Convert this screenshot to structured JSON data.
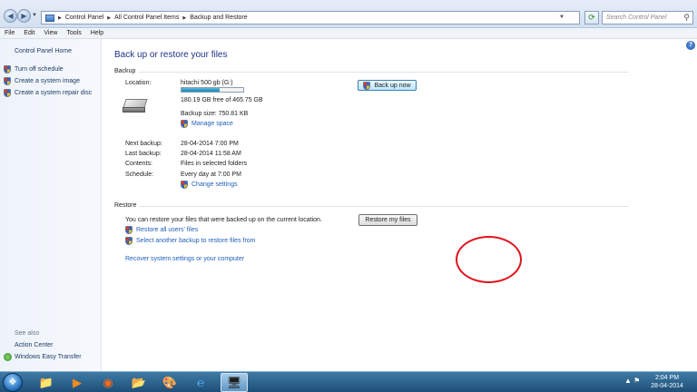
{
  "address_bar": {
    "breadcrumbs": [
      "Control Panel",
      "All Control Panel Items",
      "Backup and Restore"
    ],
    "search_placeholder": "Search Control Panel"
  },
  "menu": [
    "File",
    "Edit",
    "View",
    "Tools",
    "Help"
  ],
  "left_pane": {
    "home": "Control Panel Home",
    "links": [
      "Turn off schedule",
      "Create a system image",
      "Create a system repair disc"
    ],
    "see_also": "See also",
    "see_also_links": [
      "Action Center",
      "Windows Easy Transfer"
    ]
  },
  "main": {
    "heading": "Back up or restore your files",
    "backup": {
      "section": "Backup",
      "location_label": "Location:",
      "location_value": "hitachi 500 gb (G:)",
      "free_space": "180.19 GB free of 465.75 GB",
      "used_fraction": 0.613,
      "backup_size": "Backup size: 750.81 KB",
      "manage_space": "Manage space",
      "back_up_now": "Back up now",
      "rows": [
        {
          "label": "Next backup:",
          "value": "28-04-2014 7:00 PM"
        },
        {
          "label": "Last backup:",
          "value": "28-04-2014 11:58 AM"
        },
        {
          "label": "Contents:",
          "value": "Files in selected folders"
        },
        {
          "label": "Schedule:",
          "value": "Every day at 7:00 PM"
        }
      ],
      "change_settings": "Change settings"
    },
    "restore": {
      "section": "Restore",
      "description": "You can restore your files that were backed up on the current location.",
      "restore_my_files": "Restore my files",
      "restore_all_users": "Restore all users' files",
      "select_another": "Select another backup to restore files from",
      "recover_system": "Recover system settings or your computer"
    }
  },
  "taskbar": {
    "time": "2:04 PM",
    "date": "28-04-2014"
  },
  "colors": {
    "link": "#1f5fb8",
    "heading": "#1e3287",
    "highlight_circle": "#e0141e",
    "taskbar": "#1d4f78"
  }
}
